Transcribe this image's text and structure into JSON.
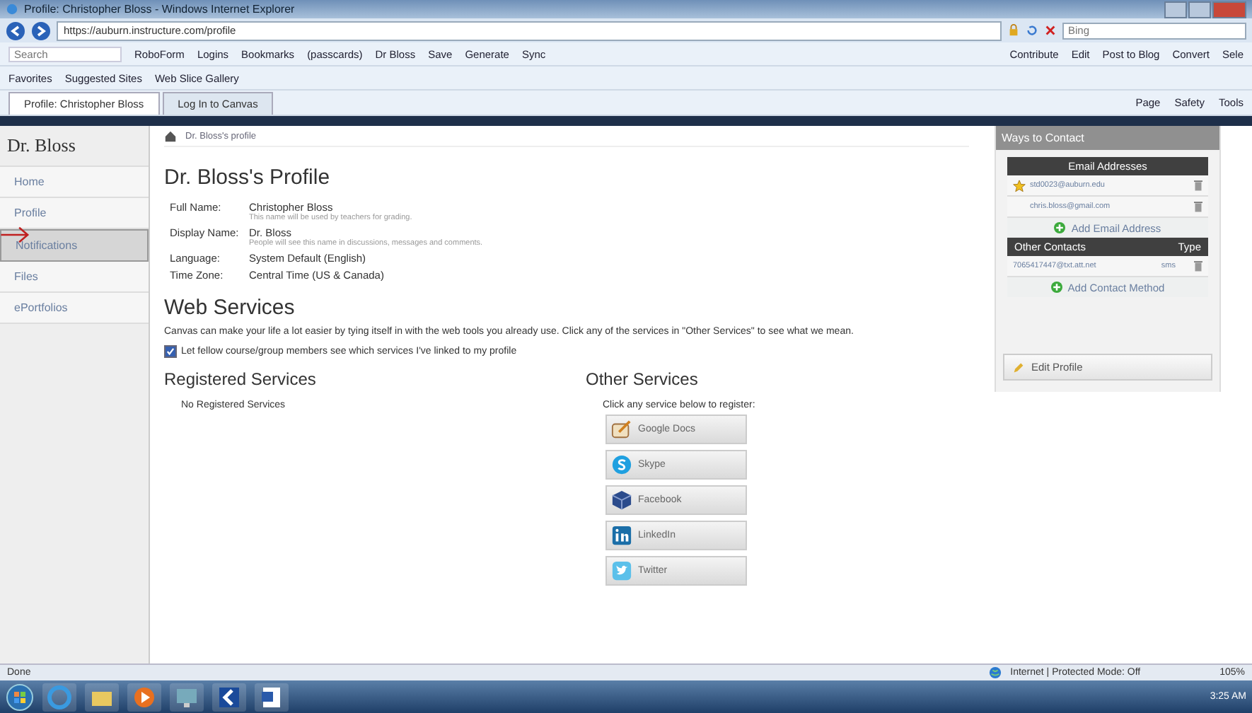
{
  "window": {
    "title": "Profile: Christopher Bloss - Windows Internet Explorer"
  },
  "address_bar": {
    "url": "https://auburn.instructure.com/profile",
    "search_placeholder": "Bing"
  },
  "toolbar": {
    "search_placeholder": "Search",
    "items": [
      "RoboForm",
      "Logins",
      "Bookmarks",
      "(passcards)",
      "Dr Bloss",
      "Save",
      "Generate",
      "Sync"
    ],
    "right_items": [
      "Contribute",
      "Edit",
      "Post to Blog",
      "Convert",
      "Sele"
    ]
  },
  "favorites_bar": [
    "Favorites",
    "Suggested Sites",
    "Web Slice Gallery"
  ],
  "tabs": [
    {
      "label": "Profile: Christopher Bloss",
      "selected": true
    },
    {
      "label": "Log In to Canvas",
      "selected": false
    }
  ],
  "command_bar": [
    "Page",
    "Safety",
    "Tools"
  ],
  "sidebar": {
    "title": "Dr. Bloss",
    "items": [
      {
        "label": "Home",
        "selected": false
      },
      {
        "label": "Profile",
        "selected": false
      },
      {
        "label": "Notifications",
        "selected": true
      },
      {
        "label": "Files",
        "selected": false
      },
      {
        "label": "ePortfolios",
        "selected": false
      }
    ]
  },
  "breadcrumb": "Dr. Bloss's profile",
  "profile": {
    "title": "Dr. Bloss's Profile",
    "fields": [
      {
        "label": "Full Name:",
        "value": "Christopher Bloss",
        "hint": "This name will be used by teachers for grading."
      },
      {
        "label": "Display Name:",
        "value": "Dr. Bloss",
        "hint": "People will see this name in discussions, messages and comments."
      },
      {
        "label": "Language:",
        "value": "System Default (English)"
      },
      {
        "label": "Time Zone:",
        "value": "Central Time (US & Canada)"
      }
    ]
  },
  "web_services": {
    "title": "Web Services",
    "description": "Canvas can make your life a lot easier by tying itself in with the web tools you already use. Click any of the services in \"Other Services\" to see what we mean.",
    "checkbox": {
      "label": "Let fellow course/group members see which services I've linked to my profile",
      "checked": true
    },
    "registered": {
      "title": "Registered Services",
      "empty_text": "No Registered Services"
    },
    "other": {
      "title": "Other Services",
      "instruction": "Click any service below to register:",
      "services": [
        {
          "name": "Google Docs",
          "kind": "google_docs"
        },
        {
          "name": "Skype",
          "kind": "skype"
        },
        {
          "name": "Facebook",
          "kind": "facebook"
        },
        {
          "name": "LinkedIn",
          "kind": "linkedin"
        },
        {
          "name": "Twitter",
          "kind": "twitter"
        }
      ]
    }
  },
  "contact": {
    "title": "Ways to Contact",
    "email_header": "Email Addresses",
    "emails": [
      {
        "address": "std0023@auburn.edu",
        "primary": true
      },
      {
        "address": "chris.bloss@gmail.com",
        "primary": false
      }
    ],
    "add_email": "Add Email Address",
    "other_header": "Other Contacts",
    "type_header": "Type",
    "contacts": [
      {
        "value": "7065417447@txt.att.net",
        "type": "sms"
      }
    ],
    "add_contact": "Add Contact Method",
    "edit_profile": "Edit Profile"
  },
  "status_bar": {
    "text": "Done",
    "zone": "Internet | Protected Mode: Off",
    "zoom": "105%"
  },
  "taskbar": {
    "time": "3:25 AM"
  }
}
